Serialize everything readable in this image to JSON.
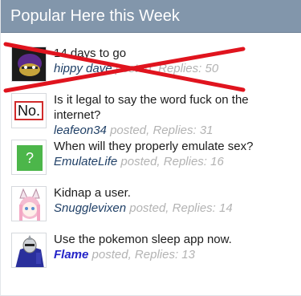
{
  "widget": {
    "title": "Popular Here this Week"
  },
  "threads": [
    {
      "title": "14 days to go",
      "username": "hippy dave",
      "posted_label": "posted,",
      "replies_label": "Replies:",
      "replies": "50",
      "avatar_icon": "purple-blob-avatar-icon",
      "struck_out": true
    },
    {
      "title": "Is it legal to say the word fuck on the internet?",
      "username": "leafeon34",
      "posted_label": "posted,",
      "replies_label": "Replies:",
      "replies": "31",
      "avatar_icon": "no-sign-avatar-icon",
      "avatar_text": "No."
    },
    {
      "title": "When will they properly emulate sex?",
      "username": "EmulateLife",
      "posted_label": "posted,",
      "replies_label": "Replies:",
      "replies": "16",
      "avatar_icon": "question-mark-avatar-icon",
      "avatar_text": "?"
    },
    {
      "title": "Kidnap a user.",
      "username": "Snugglevixen",
      "posted_label": "posted,",
      "replies_label": "Replies:",
      "replies": "14",
      "avatar_icon": "fox-girl-avatar-icon"
    },
    {
      "title": "Use the pokemon sleep app now.",
      "username": "Flame",
      "posted_label": "posted,",
      "replies_label": "Replies:",
      "replies": "13",
      "avatar_icon": "robot-avatar-icon",
      "username_style": "moderator"
    }
  ],
  "colors": {
    "header_bg": "#8296ab",
    "strike": "#e0141e",
    "username": "#1f3f66",
    "moderator_username": "#2323c8",
    "meta": "#b3b3b3"
  }
}
